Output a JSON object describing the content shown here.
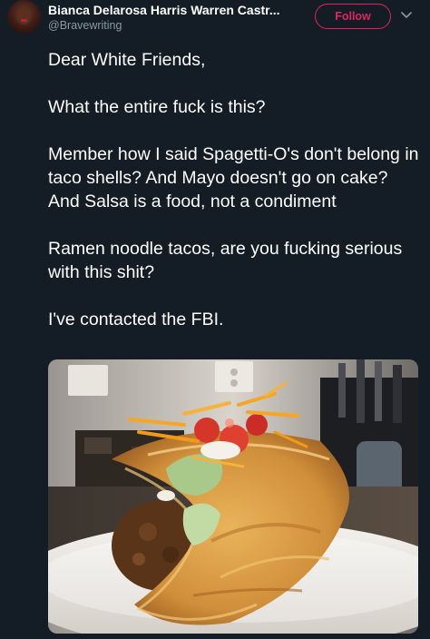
{
  "author": {
    "display_name": "Bianca Delarosa Harris Warren Castr...",
    "handle": "@Bravewriting"
  },
  "actions": {
    "follow_label": "Follow"
  },
  "tweet": {
    "paragraphs": [
      "Dear White Friends,",
      "What the entire fuck is this?",
      "Member how I said Spagetti-O's don't belong in taco shells? And Mayo doesn't go on cake? And Salsa is a food, not a condiment",
      "Ramen noodle tacos, are you fucking serious with this shit?",
      "I've contacted the FBI."
    ]
  },
  "colors": {
    "background": "#141d26",
    "accent": "#e0245e",
    "secondary_text": "#8899a6"
  },
  "icons": {
    "menu": "chevron-down-icon"
  }
}
